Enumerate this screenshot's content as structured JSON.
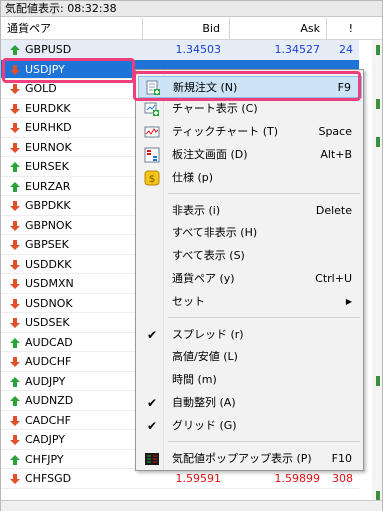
{
  "titlebar": {
    "label": "気配値表示:",
    "time": "08:32:38"
  },
  "header": {
    "symbol": "通貨ペア",
    "bid": "Bid",
    "ask": "Ask",
    "spread": "!"
  },
  "colors": {
    "accent": "#1e73d8",
    "up": "#2aa33a",
    "down": "#e0502a",
    "highlight": "#ec3f7b"
  },
  "rows": [
    {
      "symbol": "GBPUSD",
      "dir": "up",
      "bid": "1.34503",
      "ask": "1.34527",
      "spread": "24",
      "color": "blue"
    },
    {
      "symbol": "USDJPY",
      "dir": "down",
      "bid": "",
      "ask": "",
      "spread": "",
      "color": "blue"
    },
    {
      "symbol": "GOLD",
      "dir": "down",
      "bid": "",
      "ask": "",
      "spread": "",
      "color": "blue"
    },
    {
      "symbol": "EURDKK",
      "dir": "down",
      "bid": "",
      "ask": "",
      "spread": "",
      "color": "blue"
    },
    {
      "symbol": "EURHKD",
      "dir": "down",
      "bid": "",
      "ask": "",
      "spread": "",
      "color": "blue"
    },
    {
      "symbol": "EURNOK",
      "dir": "down",
      "bid": "",
      "ask": "",
      "spread": "",
      "color": "blue"
    },
    {
      "symbol": "EURSEK",
      "dir": "up",
      "bid": "",
      "ask": "",
      "spread": "",
      "color": "blue"
    },
    {
      "symbol": "EURZAR",
      "dir": "up",
      "bid": "",
      "ask": "",
      "spread": "",
      "color": "blue"
    },
    {
      "symbol": "GBPDKK",
      "dir": "down",
      "bid": "",
      "ask": "",
      "spread": "",
      "color": "blue"
    },
    {
      "symbol": "GBPNOK",
      "dir": "down",
      "bid": "",
      "ask": "",
      "spread": "",
      "color": "blue"
    },
    {
      "symbol": "GBPSEK",
      "dir": "down",
      "bid": "",
      "ask": "",
      "spread": "",
      "color": "blue"
    },
    {
      "symbol": "USDDKK",
      "dir": "down",
      "bid": "",
      "ask": "",
      "spread": "",
      "color": "blue"
    },
    {
      "symbol": "USDMXN",
      "dir": "down",
      "bid": "",
      "ask": "",
      "spread": "",
      "color": "blue"
    },
    {
      "symbol": "USDNOK",
      "dir": "down",
      "bid": "",
      "ask": "",
      "spread": "",
      "color": "blue"
    },
    {
      "symbol": "USDSEK",
      "dir": "down",
      "bid": "",
      "ask": "",
      "spread": "",
      "color": "blue"
    },
    {
      "symbol": "AUDCAD",
      "dir": "up",
      "bid": "",
      "ask": "",
      "spread": "",
      "color": "blue"
    },
    {
      "symbol": "AUDCHF",
      "dir": "down",
      "bid": "",
      "ask": "",
      "spread": "",
      "color": "blue"
    },
    {
      "symbol": "AUDJPY",
      "dir": "up",
      "bid": "",
      "ask": "",
      "spread": "",
      "color": "blue"
    },
    {
      "symbol": "AUDNZD",
      "dir": "up",
      "bid": "",
      "ask": "",
      "spread": "",
      "color": "blue"
    },
    {
      "symbol": "CADCHF",
      "dir": "down",
      "bid": "",
      "ask": "",
      "spread": "",
      "color": "blue"
    },
    {
      "symbol": "CADJPY",
      "dir": "down",
      "bid": "",
      "ask": "",
      "spread": "",
      "color": "blue"
    },
    {
      "symbol": "CHFJPY",
      "dir": "up",
      "bid": "",
      "ask": "",
      "spread": "",
      "color": "blue"
    },
    {
      "symbol": "CHFSGD",
      "dir": "down",
      "bid": "1.59591",
      "ask": "1.59899",
      "spread": "308",
      "color": "red"
    }
  ],
  "menu": {
    "items": [
      {
        "label": "新規注文 (N)",
        "shortcut": "F9",
        "icon": "new-order-icon"
      },
      {
        "label": "チャート表示 (C)",
        "shortcut": "",
        "icon": "chart-window-icon"
      },
      {
        "label": "ティックチャート (T)",
        "shortcut": "Space",
        "icon": "tick-chart-icon"
      },
      {
        "label": "板注文画面 (D)",
        "shortcut": "Alt+B",
        "icon": "depth-of-market-icon"
      },
      {
        "label": "仕様 (p)",
        "shortcut": "",
        "icon": "specification-icon"
      },
      {
        "label": "非表示 (i)",
        "shortcut": "Delete",
        "icon": ""
      },
      {
        "label": "すべて非表示 (H)",
        "shortcut": "",
        "icon": ""
      },
      {
        "label": "すべて表示 (S)",
        "shortcut": "",
        "icon": ""
      },
      {
        "label": "通貨ペア (y)",
        "shortcut": "Ctrl+U",
        "icon": ""
      },
      {
        "label": "セット",
        "shortcut": "",
        "icon": "",
        "submenu": true
      },
      {
        "label": "スプレッド (r)",
        "shortcut": "",
        "icon": "",
        "checked": true
      },
      {
        "label": "高値/安値 (L)",
        "shortcut": "",
        "icon": ""
      },
      {
        "label": "時間 (m)",
        "shortcut": "",
        "icon": ""
      },
      {
        "label": "自動整列 (A)",
        "shortcut": "",
        "icon": "",
        "checked": true
      },
      {
        "label": "グリッド (G)",
        "shortcut": "",
        "icon": "",
        "checked": true
      },
      {
        "label": "気配値ポップアップ表示 (P)",
        "shortcut": "F10",
        "icon": "popup-prices-icon"
      }
    ]
  }
}
